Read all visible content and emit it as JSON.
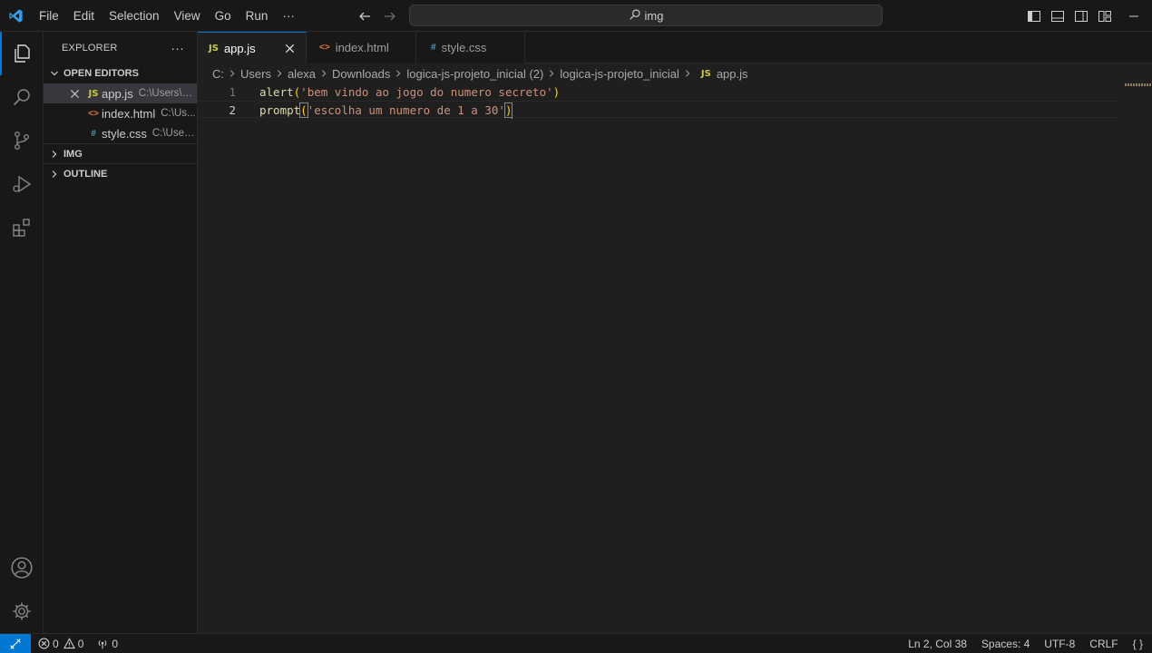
{
  "titlebar": {
    "menu": [
      "File",
      "Edit",
      "Selection",
      "View",
      "Go",
      "Run",
      "···"
    ],
    "search_text": "img"
  },
  "sidebar": {
    "title": "EXPLORER",
    "more": "···",
    "open_editors_label": "OPEN EDITORS",
    "open_editors": [
      {
        "icon": "JS",
        "name": "app.js",
        "path": "C:\\Users\\al...",
        "selected": true
      },
      {
        "icon": "<>",
        "name": "index.html",
        "path": "C:\\Us..."
      },
      {
        "icon": "#",
        "name": "style.css",
        "path": "C:\\Users..."
      }
    ],
    "folder_label": "IMG",
    "outline_label": "OUTLINE"
  },
  "tabs": [
    {
      "icon": "JS",
      "label": "app.js",
      "active": true
    },
    {
      "icon": "<>",
      "label": "index.html"
    },
    {
      "icon": "#",
      "label": "style.css"
    }
  ],
  "breadcrumb": [
    "C:",
    "Users",
    "alexa",
    "Downloads",
    "logica-js-projeto_inicial (2)",
    "logica-js-projeto_inicial",
    "app.js"
  ],
  "breadcrumb_file_icon": "JS",
  "editor": {
    "lines": [
      {
        "number": "1",
        "fn": "alert",
        "open": "(",
        "str": "'bem vindo ao jogo do numero secreto'",
        "close": ")"
      },
      {
        "number": "2",
        "fn": "prompt",
        "open": "(",
        "str": "'escolha um numero de 1 a 30'",
        "close": ")"
      }
    ]
  },
  "statusbar": {
    "errors": "0",
    "warnings": "0",
    "ports": "0",
    "position": "Ln 2, Col 38",
    "spaces": "Spaces: 4",
    "encoding": "UTF-8",
    "eol": "CRLF",
    "language": "{ }"
  },
  "colors": {
    "accent": "#0078d4",
    "js_icon": "#cbcb41",
    "html_icon": "#e37933",
    "css_icon": "#519aba",
    "function": "#dcdcaa",
    "string": "#ce9178",
    "bracket": "#ffd700"
  }
}
